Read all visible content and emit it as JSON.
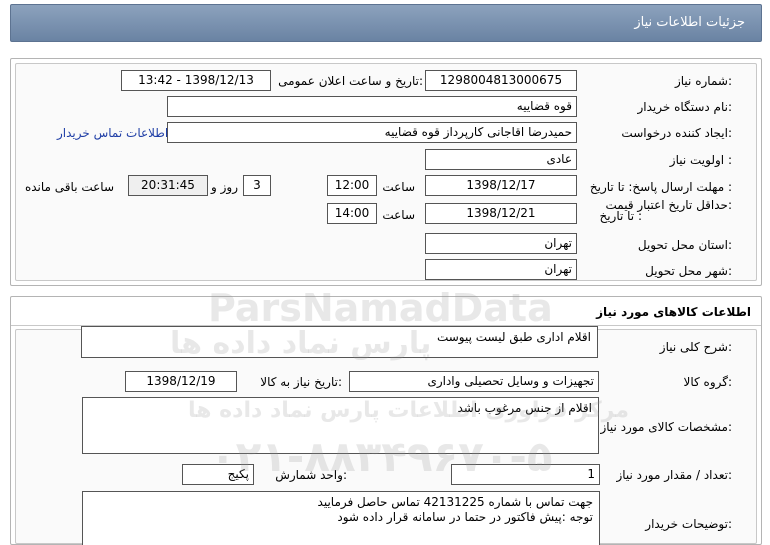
{
  "title": "جزئیات اطلاعات نیاز",
  "info": {
    "need_number_label": "شماره نیاز:",
    "need_number": "1298004813000675",
    "announce_label": "تاریخ و ساعت اعلان عمومی:",
    "announce_value": "1398/12/13 - 13:42",
    "buyer_org_label": "نام دستگاه خریدار:",
    "buyer_org": "قوه قضاییه",
    "creator_label": "ایجاد کننده درخواست:",
    "creator": "حمیدرضا اقاجانی کارپرداز قوه قضاییه",
    "contact_link": "اطلاعات تماس خریدار",
    "priority_label": "اولویت نیاز :",
    "priority": "عادی",
    "deadline_label": "مهلت ارسال پاسخ:  تا تاریخ :",
    "deadline_date": "1398/12/17",
    "time_label": "ساعت",
    "deadline_time": "12:00",
    "days": "3",
    "days_label": "روز و",
    "remaining_time": "20:31:45",
    "remaining_label": "ساعت باقی مانده",
    "validity_label": "حداقل تاریخ اعتبار قیمت:",
    "validity_to_label": "تا تاریخ :",
    "validity_date": "1398/12/21",
    "validity_time_label": "ساعت",
    "validity_time": "14:00",
    "province_label": "استان محل تحویل:",
    "province": "تهران",
    "city_label": "شهر محل تحویل:",
    "city": "تهران"
  },
  "goods": {
    "section_title": "اطلاعات کالاهای مورد نیاز",
    "desc_label": "شرح کلی نیاز:",
    "desc": "اقلام اداری طبق لیست پیوست",
    "group_label": "گروه کالا:",
    "group": "تجهیزات و وسایل تحصیلی واداری",
    "need_date_label": "تاریخ نیاز به کالا:",
    "need_date": "1398/12/19",
    "specs_label": "مشخصات کالای مورد نیاز:",
    "specs": "اقلام از جنس مرغوب باشد",
    "qty_label": "تعداد / مقدار مورد نیاز:",
    "qty": "1",
    "unit_label": "واحد شمارش:",
    "unit": "پکیج",
    "buyer_notes_label": "توضیحات خریدار:",
    "notes_line1": "جهت تماس با شماره 42131225 تماس حاصل فرمایید",
    "notes_line2": "توجه :پیش فاکتور در حتما در سامانه قرار داده شود"
  },
  "watermark": {
    "line1": "ParsNamadData",
    "line2": "پارس نماد داده ها",
    "line3": "مرکز فراوری اطلاعات پارس نماد داده ها",
    "line4": "۰۲۱-۸۸۳۴۹۶۷۰-۵"
  }
}
